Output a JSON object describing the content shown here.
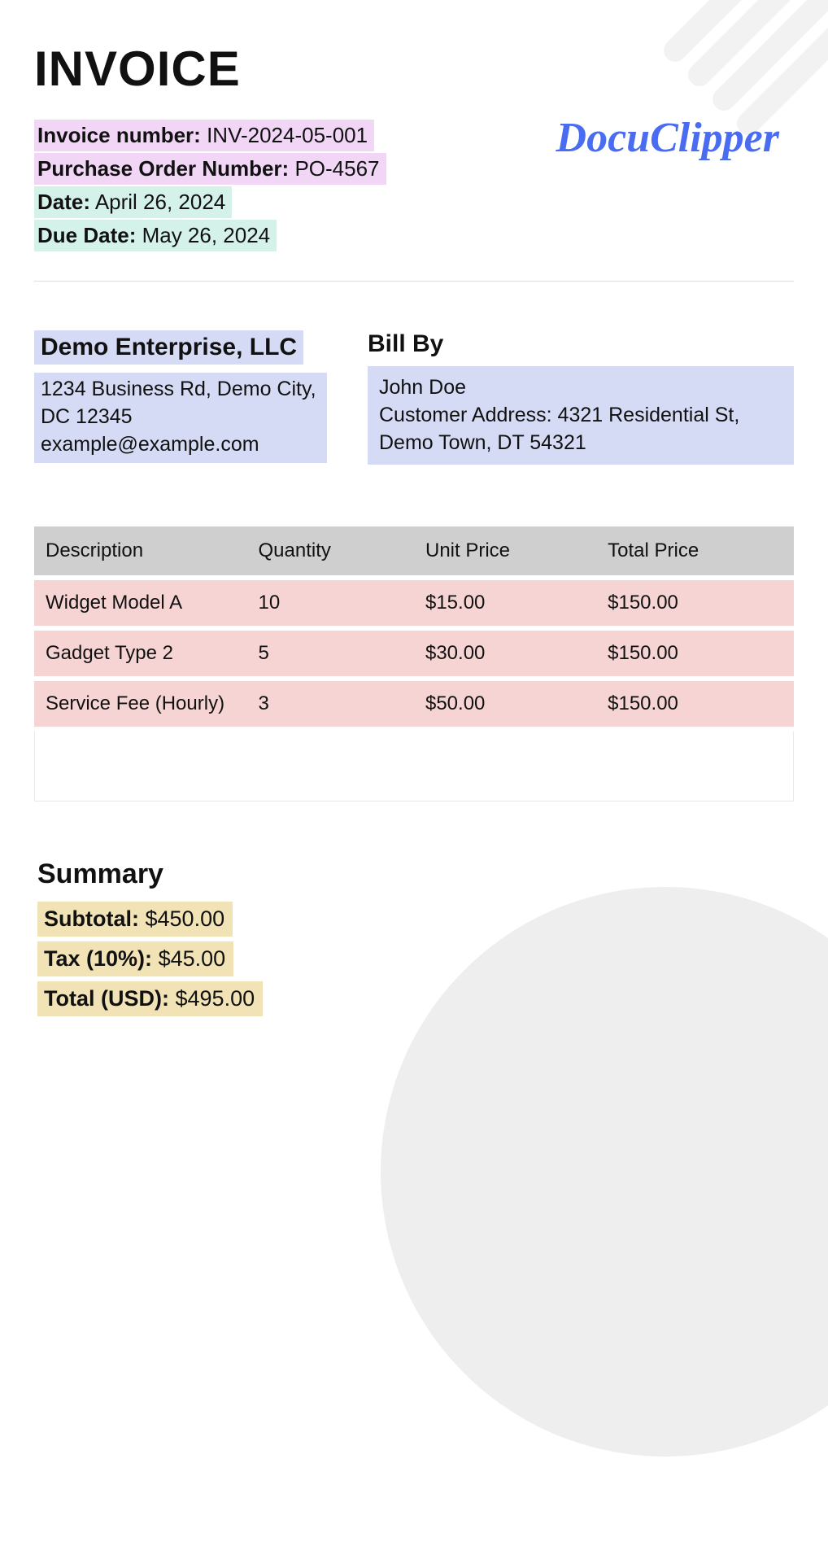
{
  "title": "INVOICE",
  "logo_text": "DocuClipper",
  "meta": {
    "invoice_number_label": "Invoice number:",
    "invoice_number_value": "INV-2024-05-001",
    "po_label": "Purchase Order Number:",
    "po_value": "PO-4567",
    "date_label": "Date:",
    "date_value": "April 26, 2024",
    "due_label": "Due Date:",
    "due_value": "May 26, 2024"
  },
  "seller": {
    "name": "Demo Enterprise, LLC",
    "address": "1234 Business Rd, Demo City, DC 12345",
    "email": "example@example.com"
  },
  "bill_by_heading": "Bill By",
  "bill_by": {
    "name": "John Doe",
    "address_label": "Customer Address:",
    "address_value": "4321 Residential St, Demo Town, DT 54321"
  },
  "table": {
    "headers": {
      "description": "Description",
      "quantity": "Quantity",
      "unit_price": "Unit Price",
      "total_price": "Total Price"
    },
    "rows": [
      {
        "description": "Widget Model A",
        "quantity": "10",
        "unit_price": "$15.00",
        "total_price": "$150.00"
      },
      {
        "description": "Gadget Type 2",
        "quantity": "5",
        "unit_price": "$30.00",
        "total_price": "$150.00"
      },
      {
        "description": "Service Fee (Hourly)",
        "quantity": "3",
        "unit_price": "$50.00",
        "total_price": "$150.00"
      }
    ]
  },
  "summary": {
    "heading": "Summary",
    "subtotal_label": "Subtotal:",
    "subtotal_value": "$450.00",
    "tax_label": "Tax (10%):",
    "tax_value": "$45.00",
    "total_label": "Total (USD):",
    "total_value": "$495.00"
  }
}
